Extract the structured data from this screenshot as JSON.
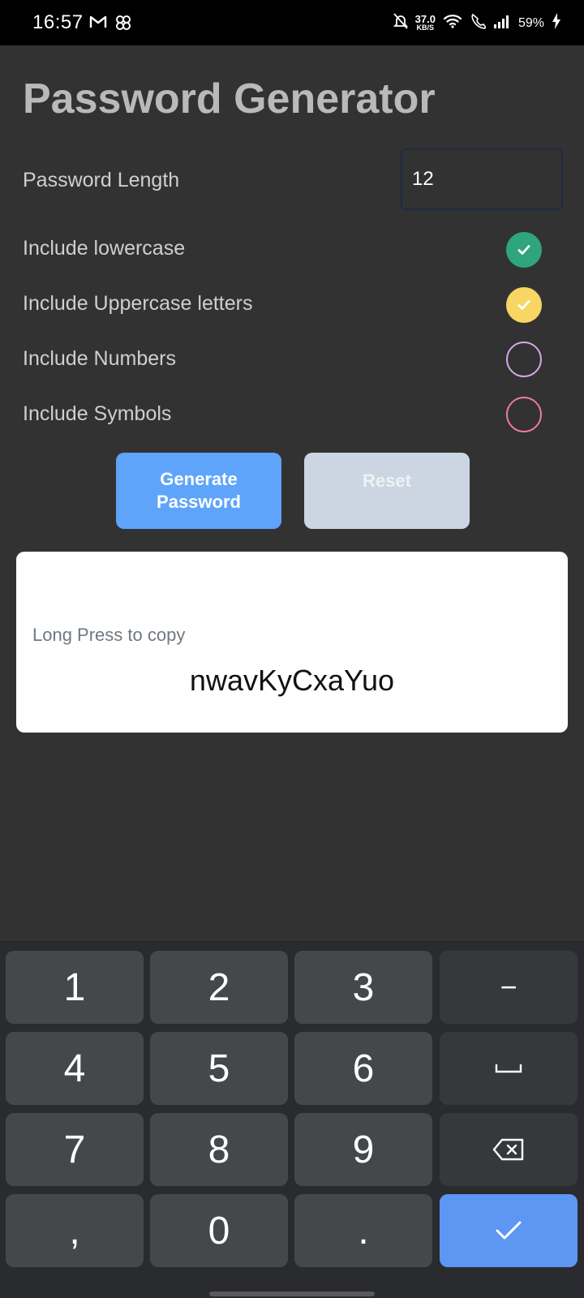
{
  "status_bar": {
    "time": "16:57",
    "left_icons": [
      "gmail-icon",
      "pinwheel-icon"
    ],
    "speed_value": "37.0",
    "speed_unit": "KB/S",
    "right_icons": [
      "mute-bell-icon",
      "wifi-icon",
      "wifi-call-icon",
      "signal-icon",
      "charging-icon"
    ],
    "battery": "59%"
  },
  "app": {
    "title": "Password Generator",
    "length_label": "Password Length",
    "length_value": "12",
    "options": [
      {
        "label": "Include lowercase",
        "checked": true,
        "color": "#2fa57e"
      },
      {
        "label": "Include Uppercase letters",
        "checked": true,
        "color": "#f8d663"
      },
      {
        "label": "Include Numbers",
        "checked": false,
        "color": "#d9a9e8"
      },
      {
        "label": "Include Symbols",
        "checked": false,
        "color": "#ef7b9f"
      }
    ],
    "generate_label": "Generate Password",
    "reset_label": "Reset",
    "result_hint": "Long Press to copy",
    "password": "nwavKyCxaYuo"
  },
  "keyboard": {
    "rows": [
      [
        "1",
        "2",
        "3",
        "−"
      ],
      [
        "4",
        "5",
        "6",
        "space-icon"
      ],
      [
        "7",
        "8",
        "9",
        "backspace-icon"
      ],
      [
        ",",
        "0",
        ".",
        "enter-check-icon"
      ]
    ],
    "enter_color": "#5e96f3"
  }
}
